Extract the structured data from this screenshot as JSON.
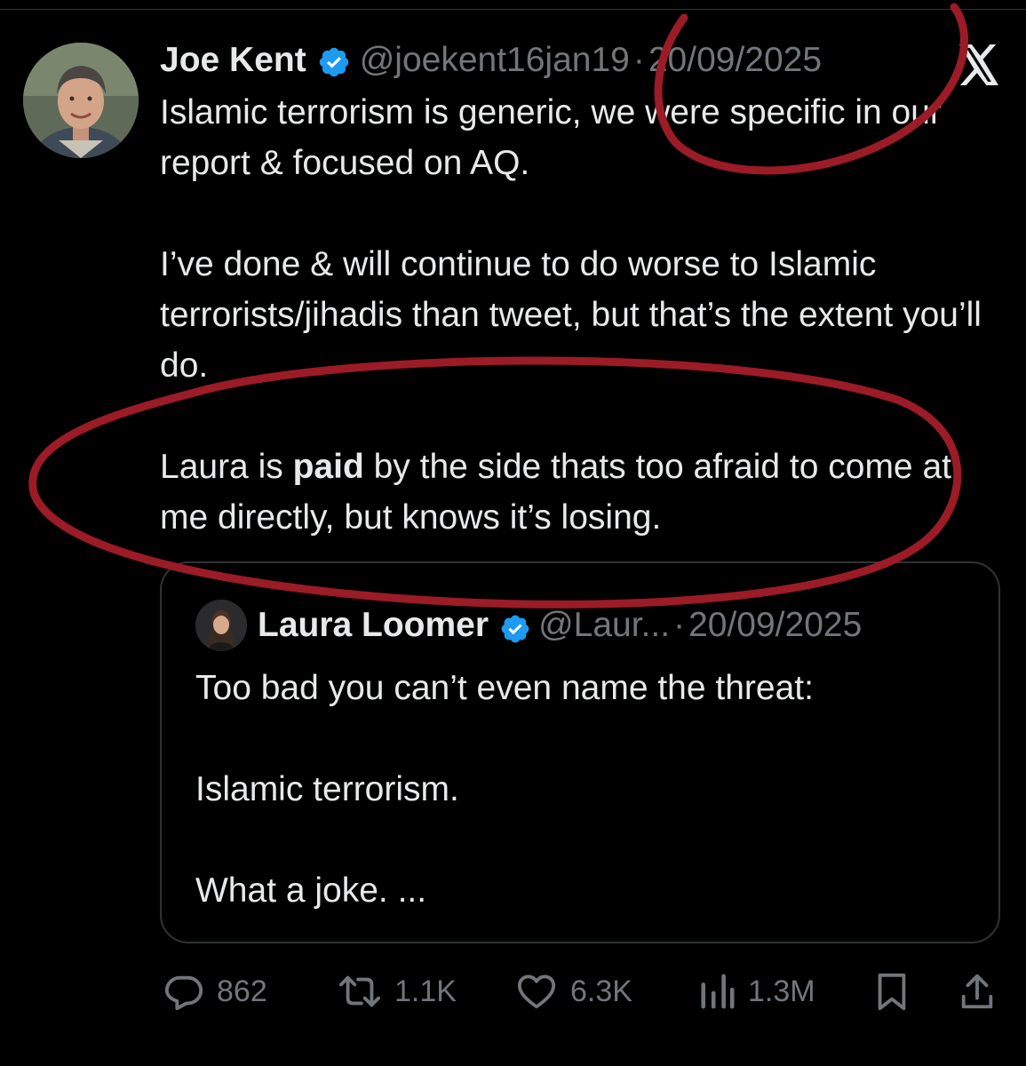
{
  "tweet": {
    "author_name": "Joe Kent",
    "handle": "@joekent16jan19",
    "separator": "·",
    "date": "20/09/2025",
    "paragraphs": {
      "p1": "Islamic terrorism is generic, we were specific in our report & focused on AQ.",
      "p2": "I’ve done & will continue to do worse to Islamic terrorists/jihadis than tweet, but that’s the extent you’ll do.",
      "p3_before": "Laura is ",
      "p3_bold": "paid",
      "p3_after": " by the side thats too afraid to come at me directly, but knows it’s losing."
    }
  },
  "quote": {
    "author_name": "Laura Loomer",
    "handle": "@Laur...",
    "separator": "·",
    "date": "20/09/2025",
    "paragraphs": {
      "p1": "Too bad you can’t even name the threat:",
      "p2": "Islamic terrorism.",
      "p3": "What a joke. ..."
    }
  },
  "actions": {
    "replies": "862",
    "reposts": "1.1K",
    "likes": "6.3K",
    "views": "1.3M"
  },
  "icons": {
    "platform_logo": "x-logo-icon",
    "verified": "verified-badge-icon",
    "reply": "reply-icon",
    "repost": "repost-icon",
    "like": "heart-icon",
    "views": "views-icon",
    "bookmark": "bookmark-icon",
    "share": "share-icon"
  },
  "colors": {
    "background": "#000000",
    "text_primary": "#e7e9ea",
    "text_secondary": "#71767b",
    "verified_blue": "#1d9bf0",
    "annotation_red": "#9b1b26"
  }
}
